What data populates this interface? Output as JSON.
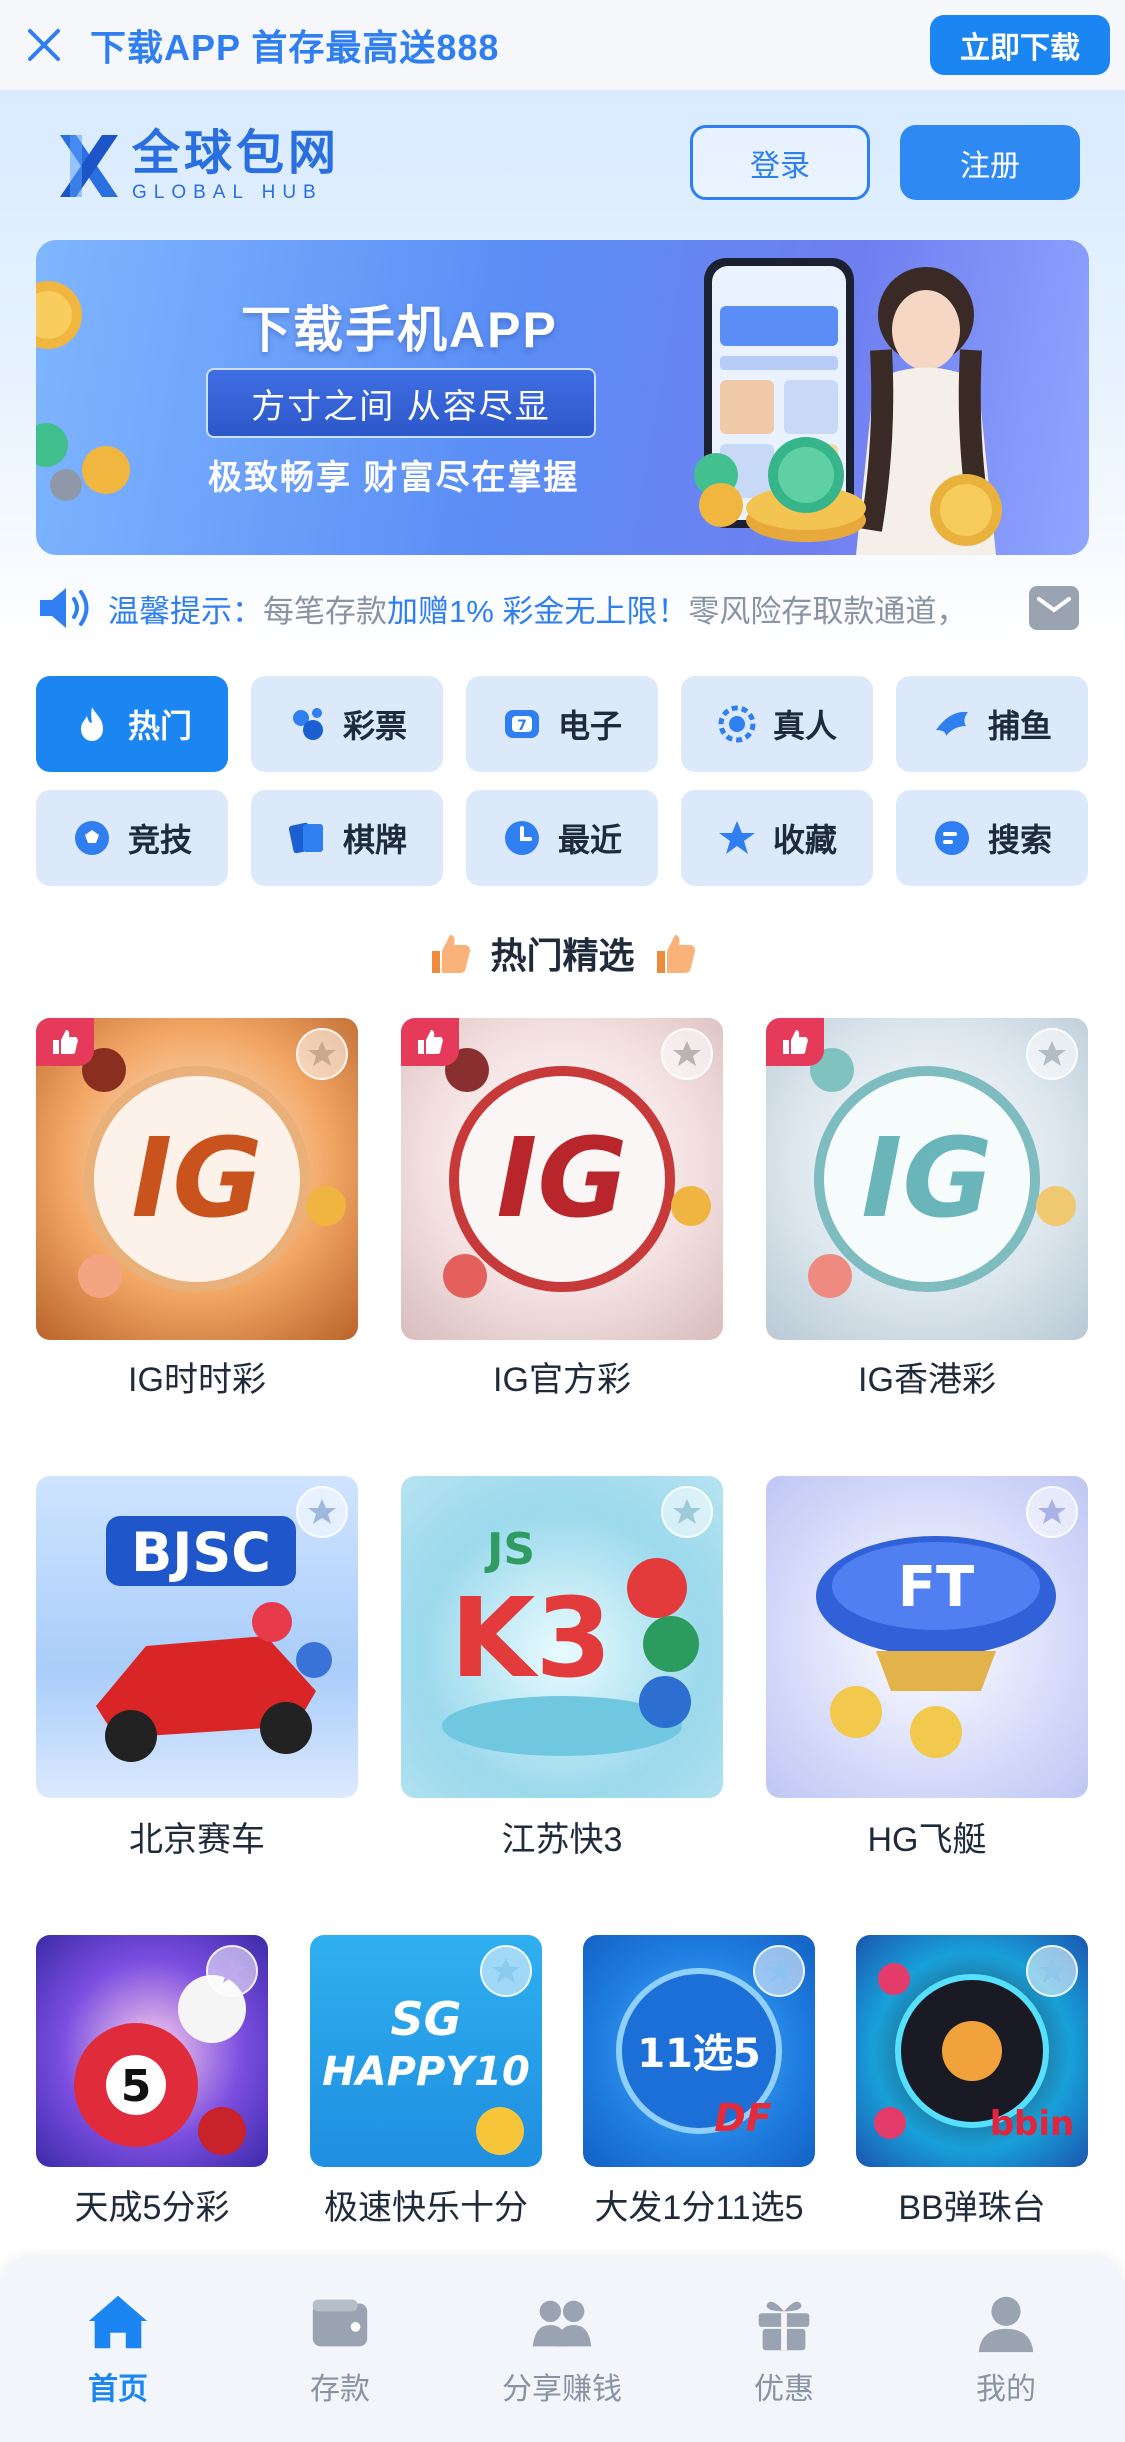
{
  "topbar": {
    "promo": "下载APP 首存最高送888",
    "download_label": "立即下载"
  },
  "header": {
    "brand_cn": "全球包网",
    "brand_en": "GLOBAL HUB",
    "login_label": "登录",
    "register_label": "注册"
  },
  "banner": {
    "title": "下载手机APP",
    "pill": "方寸之间 从容尽显",
    "subtitle": "极致畅享 财富尽在掌握"
  },
  "notice": {
    "label": "温馨提示：",
    "msg_a": "每笔存款",
    "msg_b": "加赠1% 彩金无上限！",
    "msg_c": "零风险存取款通道，"
  },
  "categories": [
    {
      "label": "热门",
      "icon": "fire-icon",
      "active": true
    },
    {
      "label": "彩票",
      "icon": "lottery-icon"
    },
    {
      "label": "电子",
      "icon": "slot-icon"
    },
    {
      "label": "真人",
      "icon": "live-icon"
    },
    {
      "label": "捕鱼",
      "icon": "fish-icon"
    },
    {
      "label": "竞技",
      "icon": "soccer-icon"
    },
    {
      "label": "棋牌",
      "icon": "cards-icon"
    },
    {
      "label": "最近",
      "icon": "clock-icon"
    },
    {
      "label": "收藏",
      "icon": "star-icon"
    },
    {
      "label": "搜索",
      "icon": "search-icon"
    }
  ],
  "section": {
    "title": "热门精选"
  },
  "games_row1": [
    {
      "label": "IG时时彩",
      "logo": "IG"
    },
    {
      "label": "IG官方彩",
      "logo": "IG"
    },
    {
      "label": "IG香港彩",
      "logo": "IG"
    }
  ],
  "games_row2": [
    {
      "label": "北京赛车",
      "logo": "SC"
    },
    {
      "label": "江苏快3",
      "logo": "K3"
    },
    {
      "label": "HG飞艇",
      "logo": "FT"
    }
  ],
  "games_row3": [
    {
      "label": "天成5分彩",
      "logo": "5"
    },
    {
      "label": "极速快乐十分",
      "logo": "HAPPY10"
    },
    {
      "label": "大发1分11选5",
      "logo": "11选5"
    },
    {
      "label": "BB弹珠台",
      "logo": "bbin"
    }
  ],
  "bottom_nav": [
    {
      "label": "首页",
      "icon": "home-icon",
      "active": true
    },
    {
      "label": "存款",
      "icon": "wallet-icon"
    },
    {
      "label": "分享赚钱",
      "icon": "share-icon"
    },
    {
      "label": "优惠",
      "icon": "gift-icon"
    },
    {
      "label": "我的",
      "icon": "profile-icon"
    }
  ],
  "colors": {
    "primary": "#1b86f2",
    "tile_bg": "#dbe9fb",
    "hot_badge": "#e63a5a"
  }
}
